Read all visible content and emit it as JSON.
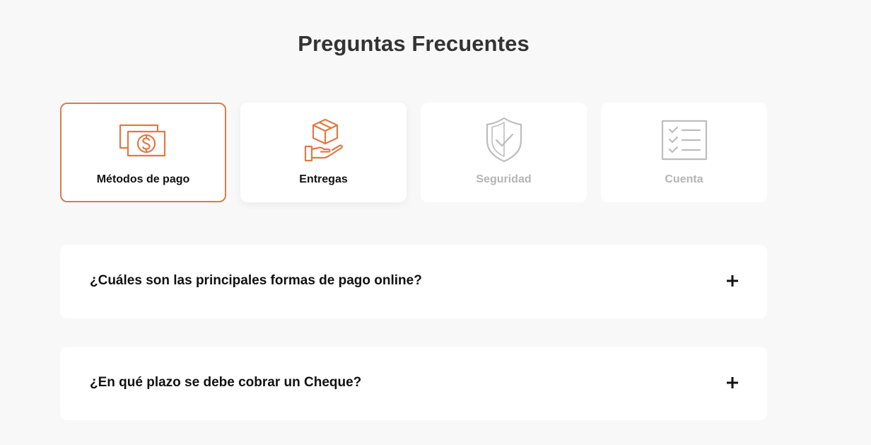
{
  "faq": {
    "title": "Preguntas Frecuentes",
    "categories": [
      {
        "label": "Métodos de pago",
        "icon": "money-bills-icon",
        "state": "selected"
      },
      {
        "label": "Entregas",
        "icon": "box-in-hand-icon",
        "state": "enabled"
      },
      {
        "label": "Seguridad",
        "icon": "shield-check-icon",
        "state": "disabled"
      },
      {
        "label": "Cuenta",
        "icon": "checklist-icon",
        "state": "disabled"
      }
    ],
    "questions": [
      {
        "text": "¿Cuáles son las principales formas de pago online?",
        "toggle_icon": "plus-icon"
      },
      {
        "text": "¿En qué plazo se debe cobrar un Cheque?",
        "toggle_icon": "plus-icon"
      }
    ]
  },
  "colors": {
    "accent": "#e07a45",
    "muted_icon": "#bdbdbd",
    "muted_text": "#b5b5b5",
    "background": "#f8f8f9",
    "card": "#ffffff",
    "title_text": "#333333"
  }
}
